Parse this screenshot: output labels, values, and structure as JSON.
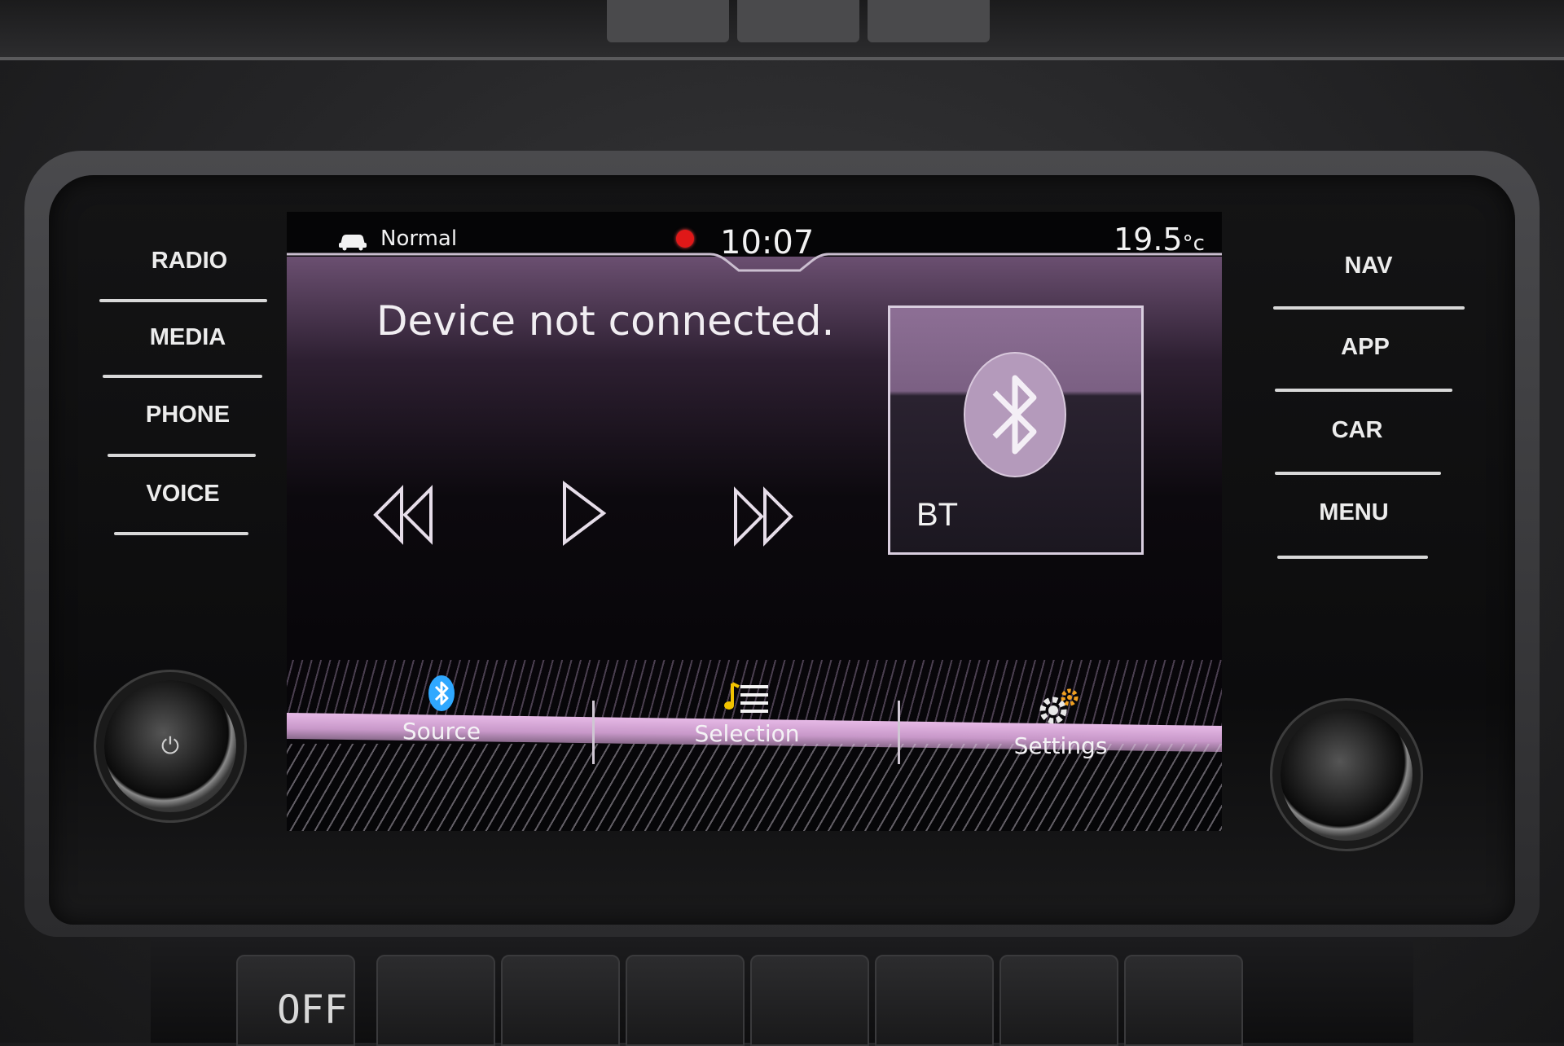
{
  "status_bar": {
    "drive_mode": "Normal",
    "time": "10:07",
    "temperature": "19.5",
    "temperature_unit": "°c",
    "icons": [
      "car-icon",
      "recording-dot-icon"
    ]
  },
  "hardware_left": [
    "RADIO",
    "MEDIA",
    "PHONE",
    "VOICE"
  ],
  "hardware_right": [
    "NAV",
    "APP",
    "CAR",
    "MENU"
  ],
  "main": {
    "message": "Device not connected.",
    "controls": [
      "rewind-icon",
      "play-icon",
      "fast-forward-icon"
    ],
    "source_tile": {
      "label": "BT",
      "icon": "bluetooth-icon"
    }
  },
  "bottom_tabs": [
    {
      "label": "Source",
      "icon": "bluetooth-icon"
    },
    {
      "label": "Selection",
      "icon": "music-list-icon"
    },
    {
      "label": "Settings",
      "icon": "gear-icon"
    }
  ],
  "climate": {
    "fan_status": "OFF"
  },
  "colors": {
    "accent_pink": "#e6b9e6",
    "text": "#f2f2f2",
    "record_dot": "#e01818",
    "bluetooth_blue": "#2fa8ff",
    "settings_orange": "#f0a020",
    "selection_yellow": "#f2c300"
  }
}
